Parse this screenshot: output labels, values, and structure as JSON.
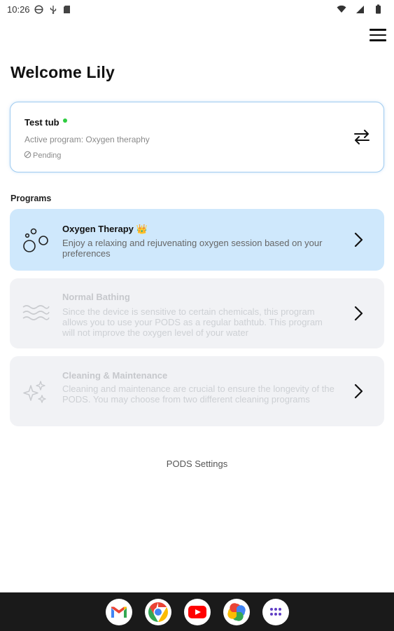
{
  "status_bar": {
    "time": "10:26",
    "icons_left": [
      "vpn-icon",
      "usb-icon",
      "sd-card-icon"
    ],
    "icons_right": [
      "wifi-icon",
      "signal-icon",
      "battery-icon"
    ]
  },
  "header": {
    "menu_icon": "hamburger-menu-icon",
    "welcome": "Welcome Lily"
  },
  "tub": {
    "name": "Test tub",
    "online": true,
    "online_color": "#2ecc40",
    "program": "Active program: Oxygen theraphy",
    "status": "Pending",
    "swap_icon": "swap-arrows-icon"
  },
  "programs": {
    "title": "Programs",
    "items": [
      {
        "title": "Oxygen Therapy 👑",
        "description": "Enjoy a relaxing and rejuvenating oxygen session based on your preferences",
        "icon": "bubbles-icon",
        "active": true
      },
      {
        "title": "Normal Bathing",
        "description": "Since the device is sensitive to certain chemicals, this program allows you to use your PODS as a regular bathtub. This program will not improve the oxygen level of your water",
        "icon": "waves-icon",
        "active": false
      },
      {
        "title": "Cleaning & Maintenance",
        "description": "Cleaning and maintenance are crucial to ensure the longevity of the PODS. You may choose from two different cleaning programs",
        "icon": "sparkles-icon",
        "active": false
      }
    ]
  },
  "settings_link": "PODS Settings",
  "dock": {
    "apps": [
      "gmail-icon",
      "chrome-icon",
      "youtube-icon",
      "photos-icon",
      "app-drawer-icon"
    ]
  },
  "colors": {
    "active_card": "#cfe8fc",
    "disabled_card": "#f1f2f5",
    "card_border": "#9fcbf0"
  }
}
